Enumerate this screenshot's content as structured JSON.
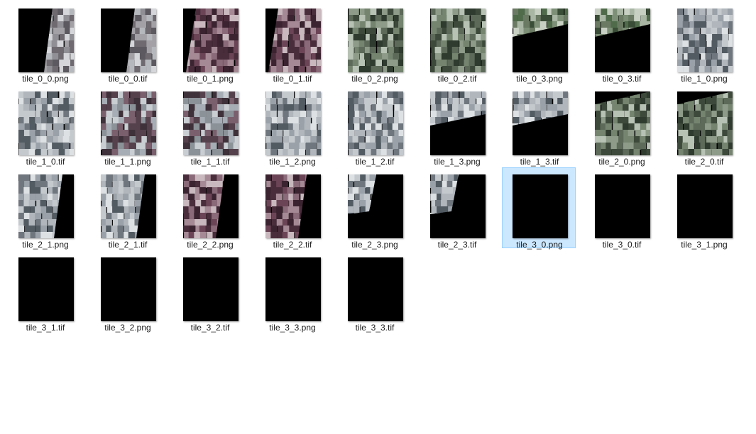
{
  "files": [
    {
      "name": "tile_0_0.png",
      "preview": "strip-right",
      "palette": "city",
      "selected": false
    },
    {
      "name": "tile_0_0.tif",
      "preview": "strip-right",
      "palette": "city",
      "selected": false
    },
    {
      "name": "tile_0_1.png",
      "preview": "mountain-wide",
      "palette": "mountain",
      "selected": false
    },
    {
      "name": "tile_0_1.tif",
      "preview": "mountain-wide",
      "palette": "mountain",
      "selected": false
    },
    {
      "name": "tile_0_2.png",
      "preview": "full",
      "palette": "fields",
      "selected": false
    },
    {
      "name": "tile_0_2.tif",
      "preview": "full",
      "palette": "fields",
      "selected": false
    },
    {
      "name": "tile_0_3.png",
      "preview": "top-wedge",
      "palette": "green",
      "selected": false
    },
    {
      "name": "tile_0_3.tif",
      "preview": "top-wedge",
      "palette": "green",
      "selected": false
    },
    {
      "name": "tile_1_0.png",
      "preview": "full",
      "palette": "greenhouse",
      "selected": false
    },
    {
      "name": "tile_1_0.tif",
      "preview": "full",
      "palette": "greenhouse",
      "selected": false
    },
    {
      "name": "tile_1_1.png",
      "preview": "full",
      "palette": "mixed",
      "selected": false
    },
    {
      "name": "tile_1_1.tif",
      "preview": "full",
      "palette": "mixed",
      "selected": false
    },
    {
      "name": "tile_1_2.png",
      "preview": "full",
      "palette": "greenhouse",
      "selected": false
    },
    {
      "name": "tile_1_2.tif",
      "preview": "full",
      "palette": "greenhouse",
      "selected": false
    },
    {
      "name": "tile_1_3.png",
      "preview": "top-slope",
      "palette": "greenhouse",
      "selected": false
    },
    {
      "name": "tile_1_3.tif",
      "preview": "top-slope",
      "palette": "greenhouse",
      "selected": false
    },
    {
      "name": "tile_2_0.png",
      "preview": "right-wedge",
      "palette": "fields",
      "selected": false
    },
    {
      "name": "tile_2_0.tif",
      "preview": "right-wedge",
      "palette": "fields",
      "selected": false
    },
    {
      "name": "tile_2_1.png",
      "preview": "left-strip",
      "palette": "greenhouse",
      "selected": false
    },
    {
      "name": "tile_2_1.tif",
      "preview": "left-strip",
      "palette": "greenhouse",
      "selected": false
    },
    {
      "name": "tile_2_2.png",
      "preview": "left-strip-wide",
      "palette": "mountain",
      "selected": false
    },
    {
      "name": "tile_2_2.tif",
      "preview": "left-strip-wide",
      "palette": "mountain",
      "selected": false
    },
    {
      "name": "tile_2_3.png",
      "preview": "corner",
      "palette": "greenhouse",
      "selected": false
    },
    {
      "name": "tile_2_3.tif",
      "preview": "corner",
      "palette": "greenhouse",
      "selected": false
    },
    {
      "name": "tile_3_0.png",
      "preview": "black",
      "palette": "none",
      "selected": true
    },
    {
      "name": "tile_3_0.tif",
      "preview": "black",
      "palette": "none",
      "selected": false
    },
    {
      "name": "tile_3_1.png",
      "preview": "black",
      "palette": "none",
      "selected": false
    },
    {
      "name": "tile_3_1.tif",
      "preview": "black",
      "palette": "none",
      "selected": false
    },
    {
      "name": "tile_3_2.png",
      "preview": "black",
      "palette": "none",
      "selected": false
    },
    {
      "name": "tile_3_2.tif",
      "preview": "black",
      "palette": "none",
      "selected": false
    },
    {
      "name": "tile_3_3.png",
      "preview": "black",
      "palette": "none",
      "selected": false
    },
    {
      "name": "tile_3_3.tif",
      "preview": "black",
      "palette": "none",
      "selected": false
    }
  ],
  "colors": {
    "selection_bg": "#cce8ff",
    "selection_border": "#99d1ff",
    "label_text": "#1a1a1a",
    "background": "#ffffff"
  }
}
